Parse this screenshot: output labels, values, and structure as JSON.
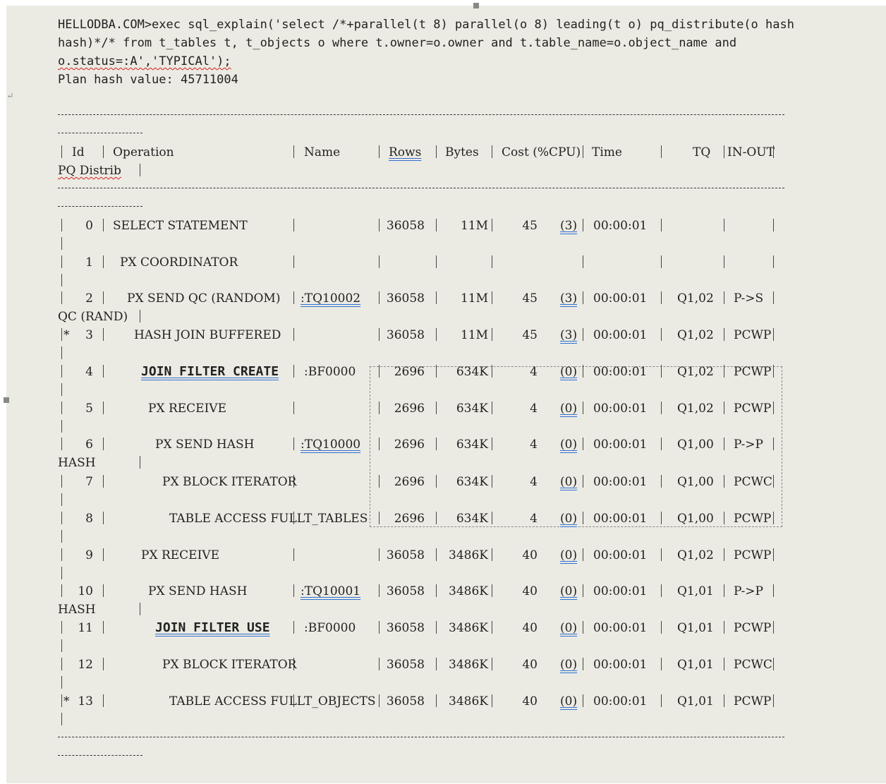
{
  "statement": {
    "line1": "HELLODBA.COM>exec sql_explain('select /*+parallel(t 8) parallel(o 8) leading(t o) pq_distribute(o hash",
    "line2": "hash)*/* from t_tables t, t_objects o where t.owner=o.owner and t.table_name=o.object_name and",
    "line3": "o.status=:A','TYPICAl');",
    "plan_hash": "Plan hash value: 45711004"
  },
  "headers": {
    "id": "Id",
    "operation": "Operation",
    "name": "Name",
    "rows": "Rows",
    "bytes": "Bytes",
    "cost": "Cost (%CPU)",
    "time": "Time",
    "tq": "TQ",
    "inout": "IN-OUT",
    "pq": "PQ Distrib"
  },
  "rows": [
    {
      "id": "0",
      "op": "SELECT STATEMENT",
      "name": "",
      "rows": "36058",
      "bytes": "11M",
      "cost": "45",
      "cpu": "(3)",
      "time": "00:00:01",
      "tq": "",
      "inout": "",
      "pq": ""
    },
    {
      "id": "1",
      "op": "PX COORDINATOR",
      "name": "",
      "rows": "",
      "bytes": "",
      "cost": "",
      "cpu": "",
      "time": "",
      "tq": "",
      "inout": "",
      "pq": ""
    },
    {
      "id": "2",
      "op": "PX SEND QC (RANDOM)",
      "name": ":TQ10002",
      "rows": "36058",
      "bytes": "11M",
      "cost": "45",
      "cpu": "(3)",
      "time": "00:00:01",
      "tq": "Q1,02",
      "inout": "P->S",
      "pq": "QC (RAND)"
    },
    {
      "id": "3",
      "star": "*",
      "op": "HASH JOIN BUFFERED",
      "name": "",
      "rows": "36058",
      "bytes": "11M",
      "cost": "45",
      "cpu": "(3)",
      "time": "00:00:01",
      "tq": "Q1,02",
      "inout": "PCWP",
      "pq": ""
    },
    {
      "id": "4",
      "op": "JOIN FILTER CREATE",
      "name": ":BF0000",
      "rows": "2696",
      "bytes": "634K",
      "cost": "4",
      "cpu": "(0)",
      "time": "00:00:01",
      "tq": "Q1,02",
      "inout": "PCWP",
      "pq": ""
    },
    {
      "id": "5",
      "op": "PX RECEIVE",
      "name": "",
      "rows": "2696",
      "bytes": "634K",
      "cost": "4",
      "cpu": "(0)",
      "time": "00:00:01",
      "tq": "Q1,02",
      "inout": "PCWP",
      "pq": ""
    },
    {
      "id": "6",
      "op": "PX SEND HASH",
      "name": ":TQ10000",
      "rows": "2696",
      "bytes": "634K",
      "cost": "4",
      "cpu": "(0)",
      "time": "00:00:01",
      "tq": "Q1,00",
      "inout": "P->P",
      "pq": "HASH"
    },
    {
      "id": "7",
      "op": "PX BLOCK ITERATOR",
      "name": "",
      "rows": "2696",
      "bytes": "634K",
      "cost": "4",
      "cpu": "(0)",
      "time": "00:00:01",
      "tq": "Q1,00",
      "inout": "PCWC",
      "pq": ""
    },
    {
      "id": "8",
      "op": "TABLE ACCESS FULL",
      "name": "T_TABLES",
      "rows": "2696",
      "bytes": "634K",
      "cost": "4",
      "cpu": "(0)",
      "time": "00:00:01",
      "tq": "Q1,00",
      "inout": "PCWP",
      "pq": ""
    },
    {
      "id": "9",
      "op": "PX RECEIVE",
      "name": "",
      "rows": "36058",
      "bytes": "3486K",
      "cost": "40",
      "cpu": "(0)",
      "time": "00:00:01",
      "tq": "Q1,02",
      "inout": "PCWP",
      "pq": ""
    },
    {
      "id": "10",
      "op": "PX SEND HASH",
      "name": ":TQ10001",
      "rows": "36058",
      "bytes": "3486K",
      "cost": "40",
      "cpu": "(0)",
      "time": "00:00:01",
      "tq": "Q1,01",
      "inout": "P->P",
      "pq": "HASH"
    },
    {
      "id": "11",
      "op": "JOIN FILTER USE",
      "name": ":BF0000",
      "rows": "36058",
      "bytes": "3486K",
      "cost": "40",
      "cpu": "(0)",
      "time": "00:00:01",
      "tq": "Q1,01",
      "inout": "PCWP",
      "pq": ""
    },
    {
      "id": "12",
      "op": "PX BLOCK ITERATOR",
      "name": "",
      "rows": "36058",
      "bytes": "3486K",
      "cost": "40",
      "cpu": "(0)",
      "time": "00:00:01",
      "tq": "Q1,01",
      "inout": "PCWC",
      "pq": ""
    },
    {
      "id": "13",
      "star": "*",
      "op": "TABLE ACCESS FULL",
      "name": "T_OBJECTS",
      "rows": "36058",
      "bytes": "3486K",
      "cost": "40",
      "cpu": "(0)",
      "time": "00:00:01",
      "tq": "Q1,01",
      "inout": "PCWP",
      "pq": ""
    }
  ],
  "colors": {
    "page": "#ecebe3",
    "text": "#222222",
    "squiggle": "#d02020",
    "link_underline": "#2f6fd0"
  }
}
